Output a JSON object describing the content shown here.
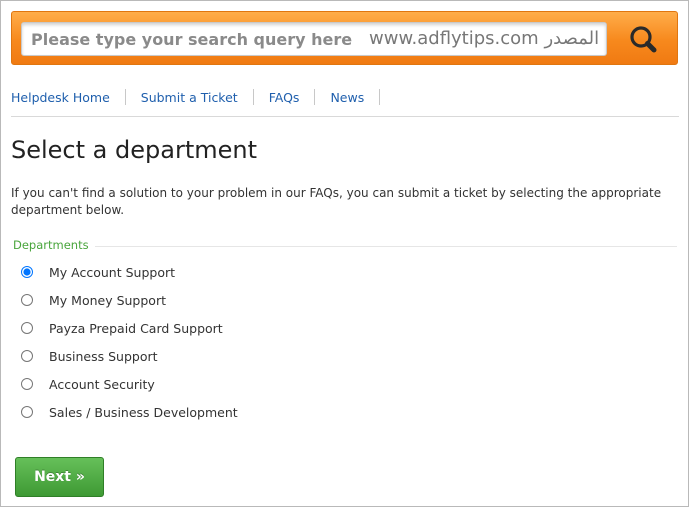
{
  "search": {
    "placeholder": "Please type your search query here",
    "watermark": "www.adflytips.com المصدر",
    "button_icon": "search-icon",
    "bar_color": "#f7891d"
  },
  "nav": {
    "items": [
      {
        "label": "Helpdesk Home"
      },
      {
        "label": "Submit a Ticket"
      },
      {
        "label": "FAQs"
      },
      {
        "label": "News"
      }
    ],
    "link_color": "#1f5fad"
  },
  "page": {
    "title": "Select a department",
    "intro": "If you can't find a solution to your problem in our FAQs, you can submit a ticket by selecting the appropriate department below."
  },
  "departments": {
    "legend": "Departments",
    "legend_color": "#49a53c",
    "selected": "My Account Support",
    "options": [
      {
        "label": "My Account Support"
      },
      {
        "label": "My Money Support"
      },
      {
        "label": "Payza Prepaid Card Support"
      },
      {
        "label": "Business Support"
      },
      {
        "label": "Account Security"
      },
      {
        "label": "Sales / Business Development"
      }
    ]
  },
  "actions": {
    "next_label": "Next »",
    "next_color": "#3e9a34"
  }
}
